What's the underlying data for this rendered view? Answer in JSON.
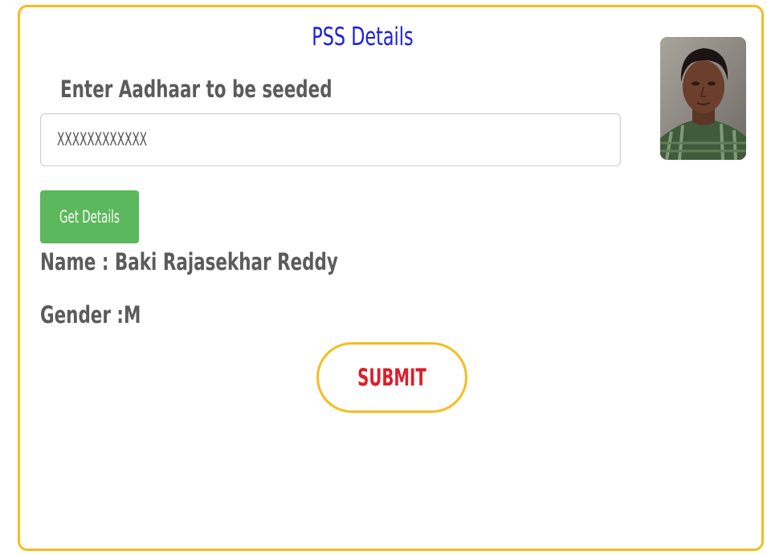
{
  "card": {
    "title": "PSS Details",
    "aadhaar_label": "Enter Aadhaar to be seeded",
    "aadhaar_input": {
      "value": "",
      "placeholder": "XXXXXXXXXXXX"
    },
    "get_details_label": "Get Details",
    "name_text": "Name : Baki Rajasekhar Reddy",
    "gender_text": "Gender :M",
    "submit_label": "SUBMIT"
  },
  "colors": {
    "border": "#f5bd1f",
    "title": "#1a1fe0",
    "label": "#5b5b5b",
    "get_details_bg": "#5cb85c",
    "submit_text": "#d9202a"
  }
}
